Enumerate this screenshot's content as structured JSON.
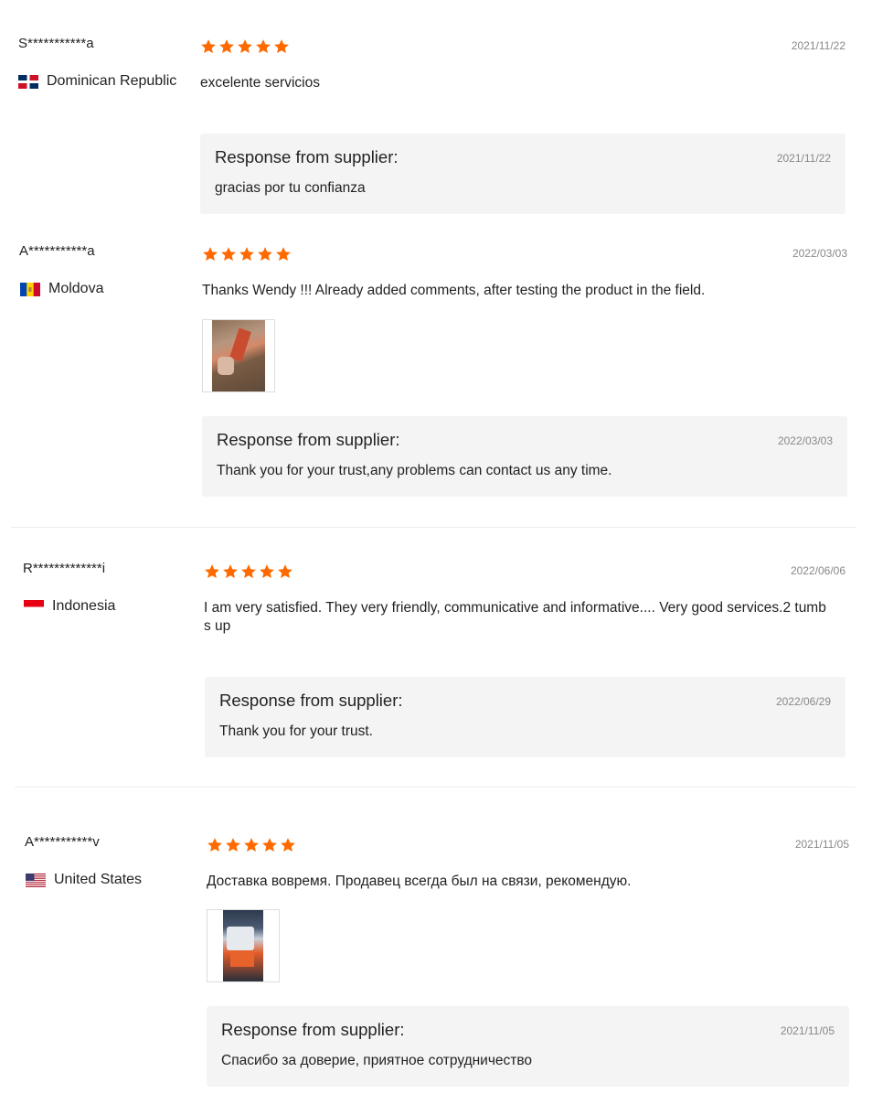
{
  "colors": {
    "star": "#ff6a00",
    "response_bg": "#f4f4f4",
    "date": "#888888"
  },
  "reviews": [
    {
      "name": "S***********a",
      "country": "Dominican Republic",
      "flag_icon": "flag-dominican-republic-icon",
      "rating": 5,
      "date": "2021/11/22",
      "comment": "excelente servicios",
      "response": {
        "title": "Response from supplier:",
        "date": "2021/11/22",
        "text": "gracias por tu confianza"
      }
    },
    {
      "name": "A***********a",
      "country": "Moldova",
      "flag_icon": "flag-moldova-icon",
      "rating": 5,
      "date": "2022/03/03",
      "comment": "Thanks Wendy !!! Already added comments, after testing the product in the field.",
      "response": {
        "title": "Response from supplier:",
        "date": "2022/03/03",
        "text": "Thank you for your trust,any problems can contact us any time."
      }
    },
    {
      "name": "R*************i",
      "country": "Indonesia",
      "flag_icon": "flag-indonesia-icon",
      "rating": 5,
      "date": "2022/06/06",
      "comment_line1": "I am very satisfied. They very friendly, communicative and informative.... Very good services.2 tumb",
      "comment_line2": "s up",
      "response": {
        "title": "Response from supplier:",
        "date": "2022/06/29",
        "text": "Thank you for your trust."
      }
    },
    {
      "name": "A***********v",
      "country": "United States",
      "flag_icon": "flag-united-states-icon",
      "rating": 5,
      "date": "2021/11/05",
      "comment": "Доставка вовремя. Продавец всегда был на связи, рекомендую.",
      "response": {
        "title": "Response from supplier:",
        "date": "2021/11/05",
        "text": "Спасибо за доверие, приятное сотрудничество"
      }
    }
  ]
}
